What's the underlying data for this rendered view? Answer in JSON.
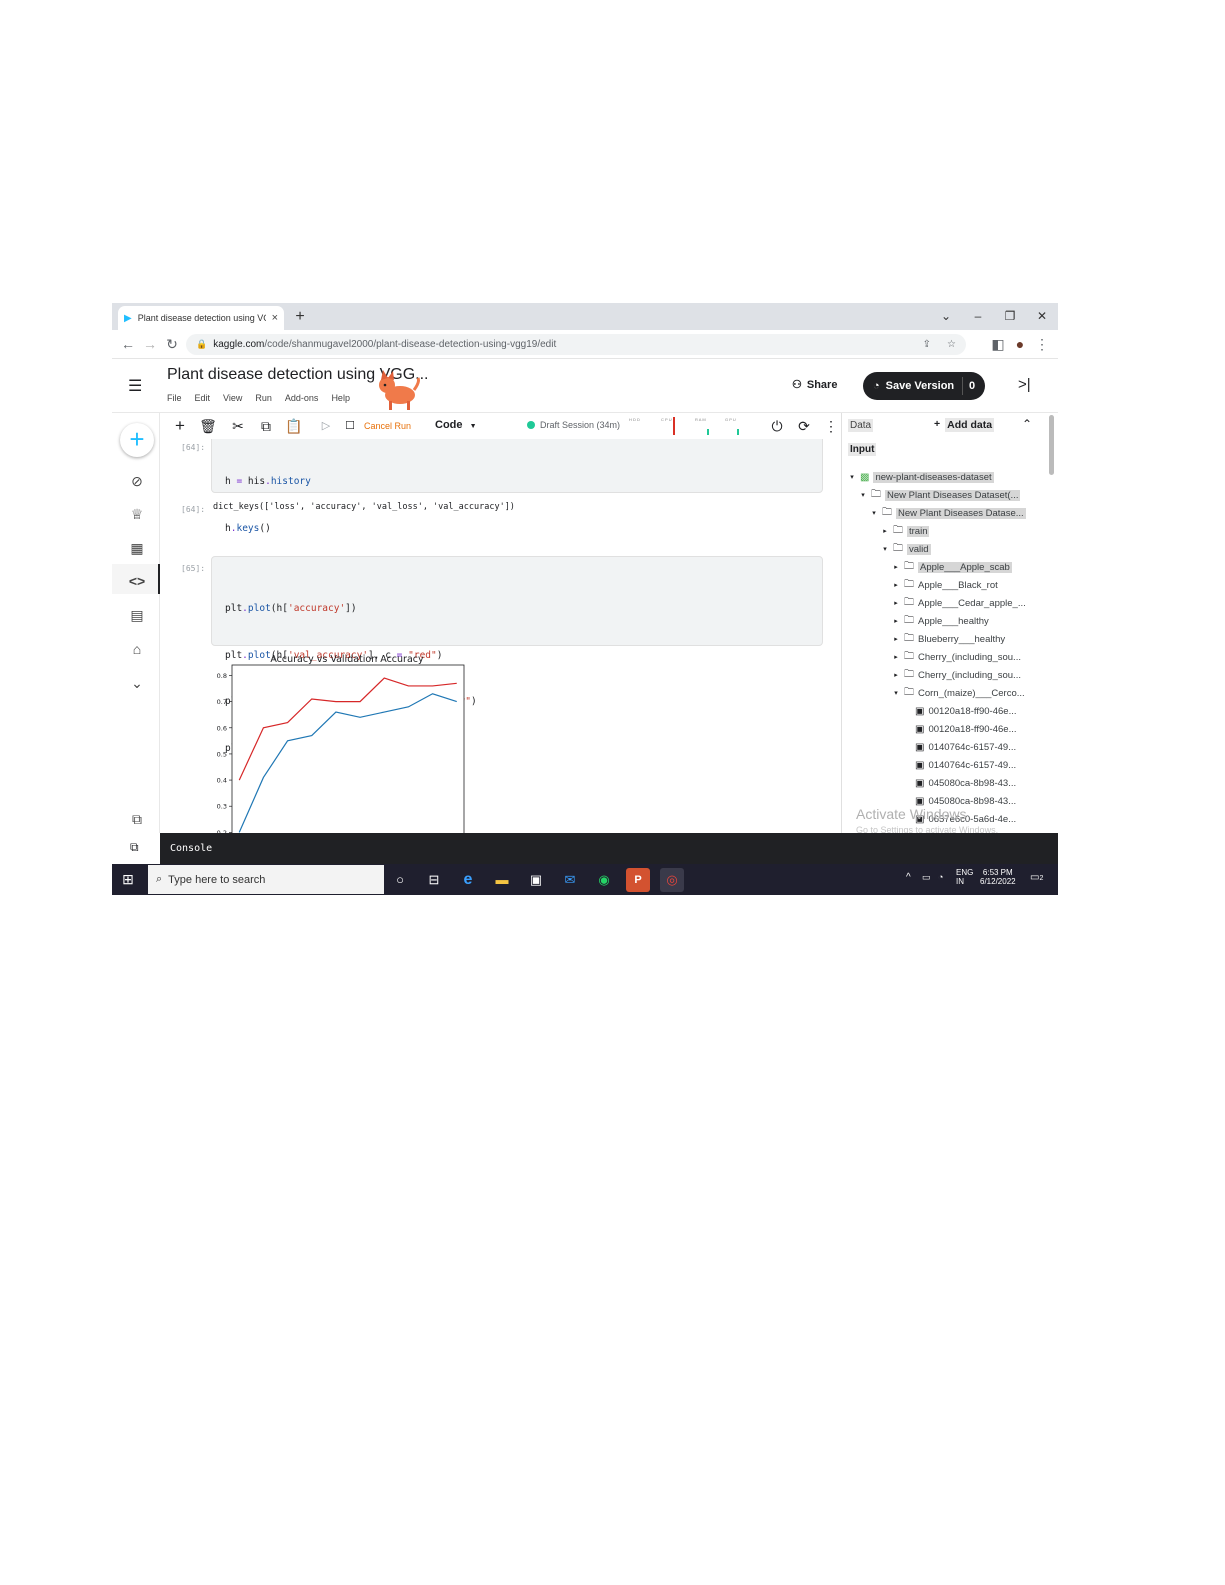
{
  "browser": {
    "tab_title": "Plant disease detection using VG",
    "tab_close": "×",
    "new_tab": "+",
    "window_controls": [
      "⌄",
      "–",
      "❐",
      "✕"
    ],
    "url_host": "kaggle.com",
    "url_path": "/code/shanmugavel2000/plant-disease-detection-using-vgg19/edit"
  },
  "header": {
    "notebook_title": "Plant disease detection using VGG...",
    "menu": [
      "File",
      "Edit",
      "View",
      "Run",
      "Add-ons",
      "Help"
    ],
    "share_label": "Share",
    "save_label": "Save Version",
    "save_count": "0"
  },
  "toolbar": {
    "cancel_label": "Cancel Run",
    "cell_type": "Code",
    "session_label": "Draft Session (34m)",
    "meters": [
      "H D D",
      "C P U",
      "R A M",
      "G P U"
    ]
  },
  "cells": [
    {
      "prompt": "[64]:",
      "code_lines": [
        "h = his.history",
        "h.keys()"
      ],
      "output_prompt": "[64]:",
      "output": "dict_keys(['loss', 'accuracy', 'val_loss', 'val_accuracy'])"
    },
    {
      "prompt": "[65]:",
      "code_lines": [
        "plt.plot(h['accuracy'])",
        "plt.plot(h['val_accuracy'], c = \"red\")",
        "plt.title(\"Accuracy vs Validation Accuracy\")",
        "plt.show()"
      ]
    }
  ],
  "chart_data": {
    "type": "line",
    "title": "Accuracy vs Validation Accuracy",
    "x": [
      0,
      1,
      2,
      3,
      4,
      5,
      6,
      7,
      8,
      9
    ],
    "ylim": [
      0.19,
      0.84
    ],
    "yticks": [
      "0.8",
      "0.7",
      "0.6",
      "0.5",
      "0.4",
      "0.3",
      "0.2"
    ],
    "series": [
      {
        "color": "#1f77b4",
        "values": [
          0.2,
          0.41,
          0.55,
          0.57,
          0.66,
          0.64,
          0.66,
          0.68,
          0.73,
          0.7
        ]
      },
      {
        "color": "#d62728",
        "values": [
          0.4,
          0.6,
          0.62,
          0.71,
          0.7,
          0.7,
          0.79,
          0.76,
          0.76,
          0.77
        ]
      }
    ]
  },
  "panel": {
    "data_label": "Data",
    "add_data_label": "Add data",
    "input_label": "Input",
    "tree": [
      {
        "label": "new-plant-diseases-dataset",
        "depth": 0,
        "arrow": "▾",
        "icon": "dataset",
        "hl": true
      },
      {
        "label": "New Plant Diseases Dataset(...",
        "depth": 1,
        "arrow": "▾",
        "icon": "folder",
        "hl": true
      },
      {
        "label": "New Plant Diseases Datase...",
        "depth": 2,
        "arrow": "▾",
        "icon": "folder",
        "hl": true
      },
      {
        "label": "train",
        "depth": 3,
        "arrow": "▸",
        "icon": "folder",
        "hl": true
      },
      {
        "label": "valid",
        "depth": 3,
        "arrow": "▾",
        "icon": "folder",
        "hl": true
      },
      {
        "label": "Apple___Apple_scab",
        "depth": 4,
        "arrow": "▸",
        "icon": "folder",
        "hl": true
      },
      {
        "label": "Apple___Black_rot",
        "depth": 4,
        "arrow": "▸",
        "icon": "folder",
        "hl": false
      },
      {
        "label": "Apple___Cedar_apple_...",
        "depth": 4,
        "arrow": "▸",
        "icon": "folder",
        "hl": false
      },
      {
        "label": "Apple___healthy",
        "depth": 4,
        "arrow": "▸",
        "icon": "folder",
        "hl": false
      },
      {
        "label": "Blueberry___healthy",
        "depth": 4,
        "arrow": "▸",
        "icon": "folder",
        "hl": false
      },
      {
        "label": "Cherry_(including_sou...",
        "depth": 4,
        "arrow": "▸",
        "icon": "folder",
        "hl": false
      },
      {
        "label": "Cherry_(including_sou...",
        "depth": 4,
        "arrow": "▸",
        "icon": "folder",
        "hl": false
      },
      {
        "label": "Corn_(maize)___Cerco...",
        "depth": 4,
        "arrow": "▾",
        "icon": "folder",
        "hl": false
      },
      {
        "label": "00120a18-ff90-46e...",
        "depth": 5,
        "arrow": "",
        "icon": "image",
        "hl": false
      },
      {
        "label": "00120a18-ff90-46e...",
        "depth": 5,
        "arrow": "",
        "icon": "image",
        "hl": false
      },
      {
        "label": "0140764c-6157-49...",
        "depth": 5,
        "arrow": "",
        "icon": "image",
        "hl": false
      },
      {
        "label": "0140764c-6157-49...",
        "depth": 5,
        "arrow": "",
        "icon": "image",
        "hl": false
      },
      {
        "label": "045080ca-8b98-43...",
        "depth": 5,
        "arrow": "",
        "icon": "image",
        "hl": false
      },
      {
        "label": "045080ca-8b98-43...",
        "depth": 5,
        "arrow": "",
        "icon": "image",
        "hl": false
      },
      {
        "label": "0657e6c0-5a6d-4e...",
        "depth": 5,
        "arrow": "",
        "icon": "image",
        "hl": false
      }
    ],
    "watermark": "Activate Windows",
    "watermark_sub": "Go to Settings to activate Windows."
  },
  "console": {
    "label": "Console"
  },
  "taskbar": {
    "search_placeholder": "Type here to search",
    "lang": "ENG",
    "region": "IN",
    "time": "6:53 PM",
    "date": "6/12/2022",
    "notification_count": "2"
  }
}
